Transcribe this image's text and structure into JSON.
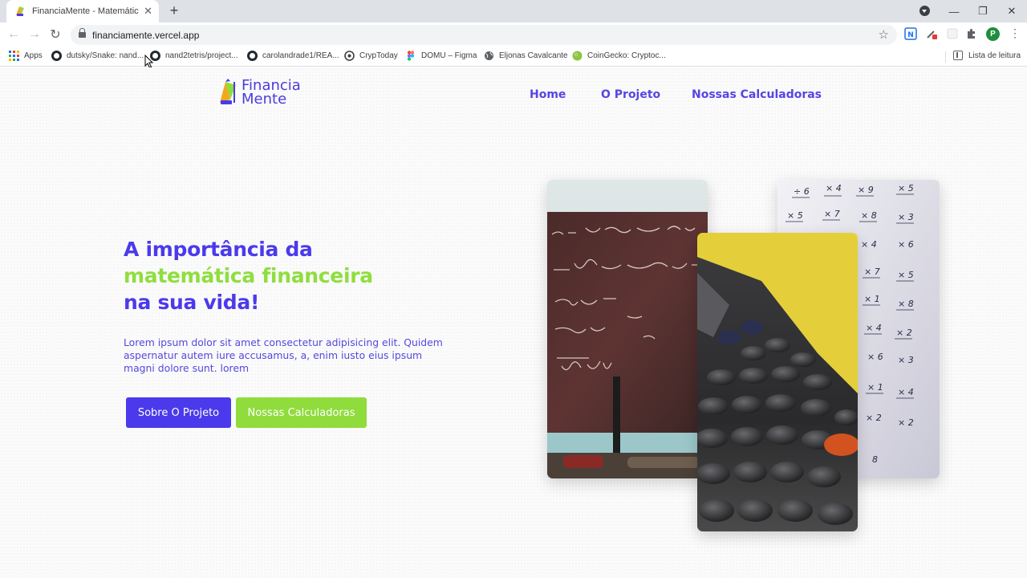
{
  "browser": {
    "tab_title": "FinanciaMente - Matemática Fina",
    "url": "financiamente.vercel.app",
    "bookmarks": [
      {
        "label": "Apps",
        "icon": "apps-grid-icon"
      },
      {
        "label": "dutsky/Snake: nand...",
        "icon": "github-icon"
      },
      {
        "label": "nand2tetris/project...",
        "icon": "github-icon"
      },
      {
        "label": "carolandrade1/REA...",
        "icon": "github-icon"
      },
      {
        "label": "CrypToday",
        "icon": "cryptoday-icon"
      },
      {
        "label": "DOMU – Figma",
        "icon": "figma-icon"
      },
      {
        "label": "Eljonas Cavalcante",
        "icon": "globe-icon"
      },
      {
        "label": "CoinGecko: Cryptoc...",
        "icon": "coingecko-icon"
      }
    ],
    "reading_list": "Lista de leitura",
    "profile_initial": "P"
  },
  "site": {
    "logo": {
      "line1": "Financia",
      "line2": "Mente"
    },
    "nav": [
      {
        "label": "Home"
      },
      {
        "label": "O Projeto"
      },
      {
        "label": "Nossas Calculadoras"
      }
    ],
    "hero": {
      "title_line1": "A importância da",
      "title_line2": "matemática financeira",
      "title_line3": "na sua vida!",
      "text": "Lorem ipsum dolor sit amet consectetur adipisicing elit. Quidem aspernatur autem iure accusamus, a, enim iusto eius ipsum magni dolore sunt. lorem",
      "primary_button": "Sobre O Projeto",
      "secondary_button": "Nossas Calculadoras"
    }
  },
  "colors": {
    "brand_purple": "#4a3aec",
    "brand_green": "#8fdc3c"
  }
}
